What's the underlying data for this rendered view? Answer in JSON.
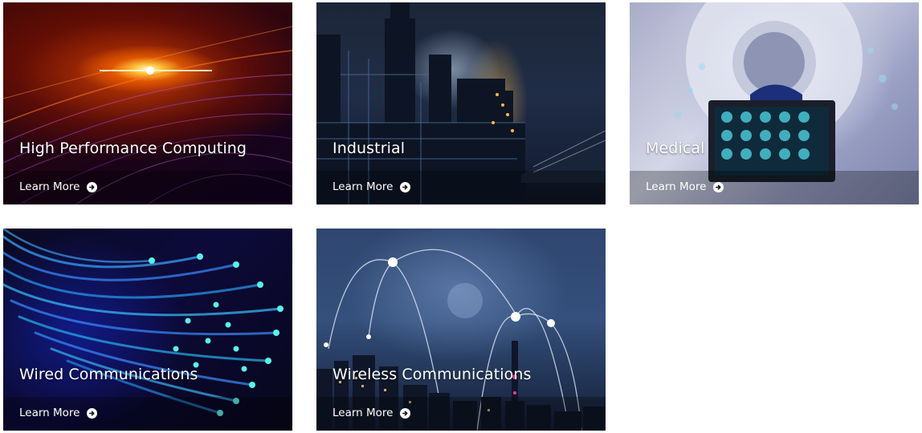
{
  "cards": [
    {
      "title": "High Performance Computing",
      "link_label": "Learn More",
      "icon": "arrow-circle-right-icon"
    },
    {
      "title": "Industrial",
      "link_label": "Learn More",
      "icon": "arrow-circle-right-icon"
    },
    {
      "title": "Medical",
      "link_label": "Learn More",
      "icon": "arrow-circle-right-icon"
    },
    {
      "title": "Wired Communications",
      "link_label": "Learn More",
      "icon": "arrow-circle-right-icon"
    },
    {
      "title": "Wireless Communications",
      "link_label": "Learn More",
      "icon": "arrow-circle-right-icon"
    }
  ],
  "colors": {
    "text": "#ffffff",
    "background": "#ffffff"
  }
}
